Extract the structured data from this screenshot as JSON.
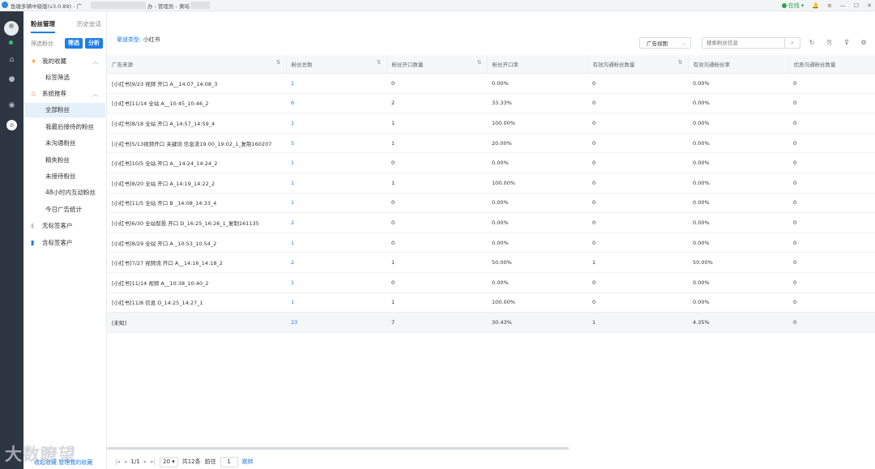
{
  "titlebar": {
    "app_title": "鱼塘多辆中级版(v3.0.89) - 广",
    "title_suffix": "办 - 管理员 - 黄瑶",
    "online": "在线"
  },
  "left": {
    "tabs": [
      "粉丝管理",
      "历史会话"
    ],
    "filter_label": "筛选粉丝",
    "filter_button": "筛选",
    "analyze_button": "分析",
    "favorites": "我的收藏",
    "tag_filter": "标签筛选",
    "system_recommend": "系统推荐",
    "sub_items": [
      "全部粉丝",
      "我最后接待的粉丝",
      "未沟通粉丝",
      "精失粉丝",
      "未接待粉丝",
      "48小时内互动粉丝",
      "今日广告统计"
    ],
    "no_tag_customers": "无标签客户",
    "tagged_customers": "含标签客户",
    "bottom_links": "收起收藏    管理我的收藏",
    "watermark": "大数瞭望"
  },
  "main": {
    "channel_label": "渠道类型:",
    "channel_value": "小红书",
    "view_select": "广告视图",
    "search_placeholder": "搜索粉丝信息",
    "columns": [
      "广告来源",
      "粉丝总数",
      "粉丝开口数量",
      "粉丝开口率",
      "有效沟通粉丝数量",
      "有效沟通粉丝率",
      "优质沟通粉丝数量"
    ],
    "rows": [
      [
        "[小红书]9/23 视频 开口 A__14:07_14:08_3",
        "1",
        "0",
        "0.00%",
        "0",
        "0.00%",
        "0"
      ],
      [
        "[小红书]11/14 全站 A__10:45_10:46_2",
        "6",
        "2",
        "33.33%",
        "0",
        "0.00%",
        "0"
      ],
      [
        "[小红书]8/18 全站 开口 A_14:57_14:59_4",
        "1",
        "1",
        "100.00%",
        "0",
        "0.00%",
        "0"
      ],
      [
        "[小红书]5/13视频开口 关键词 信息流19.00_19:02_1_复制160207",
        "5",
        "1",
        "20.00%",
        "0",
        "0.00%",
        "0"
      ],
      [
        "[小红书]10/5 全站 开口 A__14:24_14:24_2",
        "1",
        "0",
        "0.00%",
        "0",
        "0.00%",
        "0"
      ],
      [
        "[小红书]8/20 全站 开口 A_14:19_14:22_2",
        "1",
        "1",
        "100.00%",
        "0",
        "0.00%",
        "0"
      ],
      [
        "[小红书]11/5 全站 开口 B _14:08_14:33_4",
        "1",
        "0",
        "0.00%",
        "0",
        "0.00%",
        "0"
      ],
      [
        "[小红书]6/30 全站智投 开口 D_16:25_16:26_1_复制161135",
        "2",
        "0",
        "0.00%",
        "0",
        "0.00%",
        "0"
      ],
      [
        "[小红书]8/29 全站 开口 A _10:53_10:54_2",
        "1",
        "0",
        "0.00%",
        "0",
        "0.00%",
        "0"
      ],
      [
        "[小红书]7/27 视频流 开口 A__14:16_14:18_2",
        "2",
        "1",
        "50.00%",
        "1",
        "50.00%",
        "0"
      ],
      [
        "[小红书]11/14 视频 A__10:38_10:40_2",
        "1",
        "0",
        "0.00%",
        "0",
        "0.00%",
        "0"
      ],
      [
        "[小红书]11/8 信息 D_14:25_14:27_1",
        "1",
        "1",
        "100.00%",
        "0",
        "0.00%",
        "0"
      ],
      [
        "[未知]",
        "23",
        "7",
        "30.43%",
        "1",
        "4.35%",
        "0"
      ]
    ],
    "pager": {
      "page": "1/1",
      "page_size": "20",
      "total": "共12条",
      "goto_label": "前往",
      "goto_value": "1",
      "jump": "跳转"
    }
  },
  "colors": {
    "accent": "#1e7ee8",
    "rail": "#2d3642",
    "online": "#2da44e"
  }
}
